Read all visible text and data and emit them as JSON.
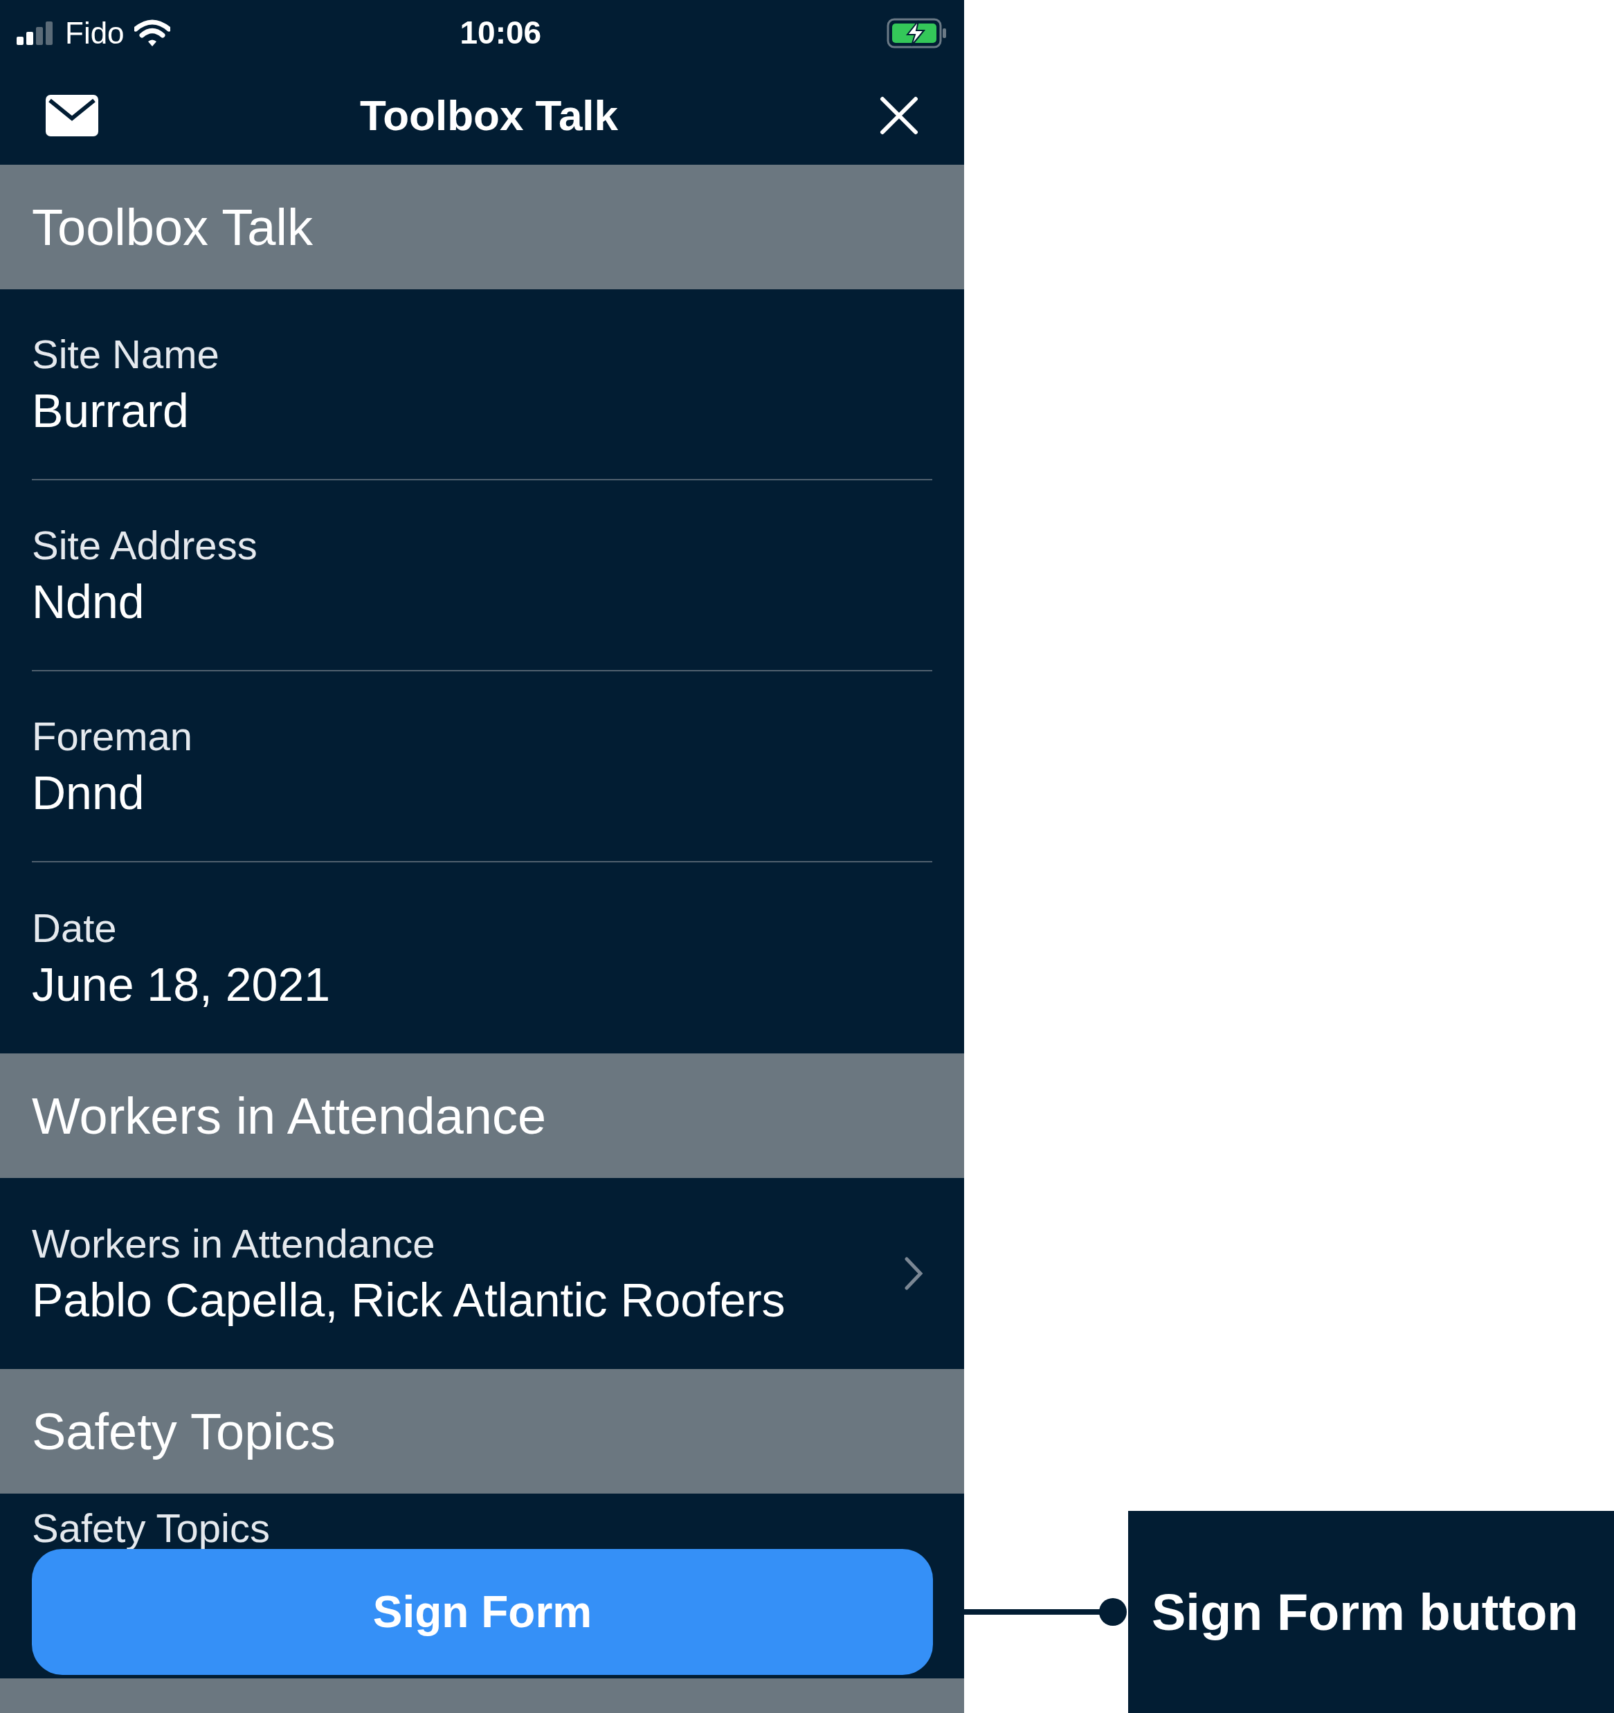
{
  "status_bar": {
    "carrier": "Fido",
    "time": "10:06"
  },
  "nav_bar": {
    "title": "Toolbox Talk"
  },
  "sections": [
    {
      "header": "Toolbox Talk",
      "fields": [
        {
          "label": "Site Name",
          "value": "Burrard",
          "has_chevron": false
        },
        {
          "label": "Site Address",
          "value": "Ndnd",
          "has_chevron": false
        },
        {
          "label": "Foreman",
          "value": "Dnnd",
          "has_chevron": false
        },
        {
          "label": "Date",
          "value": "June 18, 2021",
          "has_chevron": false
        }
      ]
    },
    {
      "header": "Workers in Attendance",
      "fields": [
        {
          "label": "Workers in Attendance",
          "value": "Pablo Capella, Rick Atlantic Roofers",
          "has_chevron": true
        }
      ]
    },
    {
      "header": "Safety Topics",
      "fields": [
        {
          "label": "Safety Topics",
          "has_chevron": false
        }
      ]
    }
  ],
  "sign_button": {
    "label": "Sign Form"
  },
  "callout": {
    "text": "Sign Form button"
  }
}
